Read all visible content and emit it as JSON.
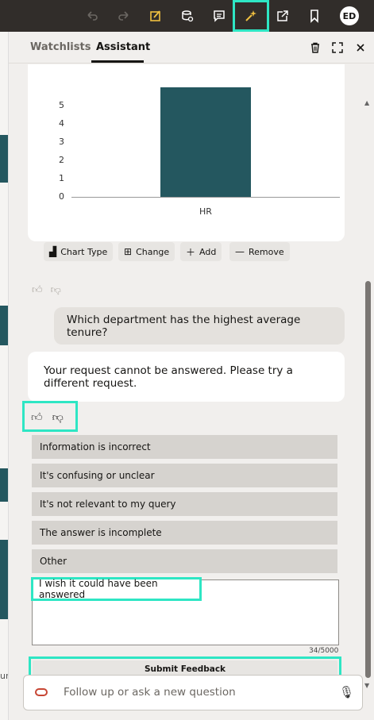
{
  "toolbar": {
    "user_initials": "ED",
    "icons": [
      "undo-icon",
      "redo-icon",
      "edit-icon",
      "data-icon",
      "comment-icon",
      "assistant-sparkle-icon",
      "share-icon",
      "bookmark-icon"
    ]
  },
  "panel": {
    "tabs": [
      {
        "label": "Watchlists"
      },
      {
        "label": "Assistant",
        "active": true
      }
    ]
  },
  "chart_data": {
    "type": "bar",
    "categories": [
      "HR"
    ],
    "values": [
      6
    ],
    "y_ticks": [
      "5",
      "4",
      "3",
      "2",
      "1",
      "0"
    ],
    "ylim": [
      0,
      6
    ]
  },
  "chart_actions": {
    "chart_type": "Chart Type",
    "change": "Change",
    "add": "Add",
    "remove": "Remove"
  },
  "conversation": {
    "user_question": "Which department has the highest average tenure?",
    "bot_reply": "Your request cannot be answered. Please try a different request."
  },
  "feedback": {
    "options": [
      "Information is incorrect",
      "It's confusing or unclear",
      "It's not relevant to my query",
      "The answer is incomplete",
      "Other"
    ],
    "comment_value": "I wish it could have been answered",
    "counter": "34/5000",
    "submit_label": "Submit Feedback"
  },
  "input": {
    "placeholder": "Follow up or ask a new question"
  },
  "background": {
    "partial_text": "ur"
  },
  "colors": {
    "topbar": "#312d2a",
    "highlight": "#2ee6c4",
    "bar": "#24575f",
    "brand": "#c74634"
  }
}
